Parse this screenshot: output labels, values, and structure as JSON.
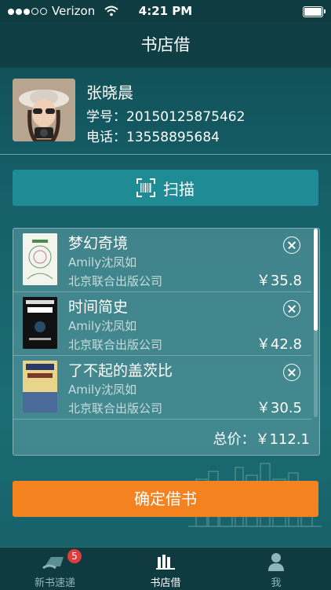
{
  "status_bar": {
    "carrier": "Verizon",
    "time": "4:21 PM"
  },
  "nav": {
    "title": "书店借"
  },
  "profile": {
    "name": "张晓晨",
    "student_id": "学号：20150125875462",
    "phone": "电话：13558895684"
  },
  "scan": {
    "label": "扫描"
  },
  "books": [
    {
      "title": "梦幻奇境",
      "author": "Amily沈凤如",
      "publisher": "北京联合出版公司",
      "price": "￥35.8"
    },
    {
      "title": "时间简史",
      "author": "Amily沈凤如",
      "publisher": "北京联合出版公司",
      "price": "￥42.8"
    },
    {
      "title": "了不起的盖茨比",
      "author": "Amily沈凤如",
      "publisher": "北京联合出版公司",
      "price": "￥30.5"
    }
  ],
  "total": "总价：￥112.1",
  "confirm": {
    "label": "确定借书"
  },
  "tabs": [
    {
      "label": "新书速递",
      "badge": "5"
    },
    {
      "label": "书店借"
    },
    {
      "label": "我"
    }
  ],
  "colors": {
    "accent": "#f4821f",
    "scan_button": "#1f8b95",
    "badge": "#e23b3b"
  }
}
